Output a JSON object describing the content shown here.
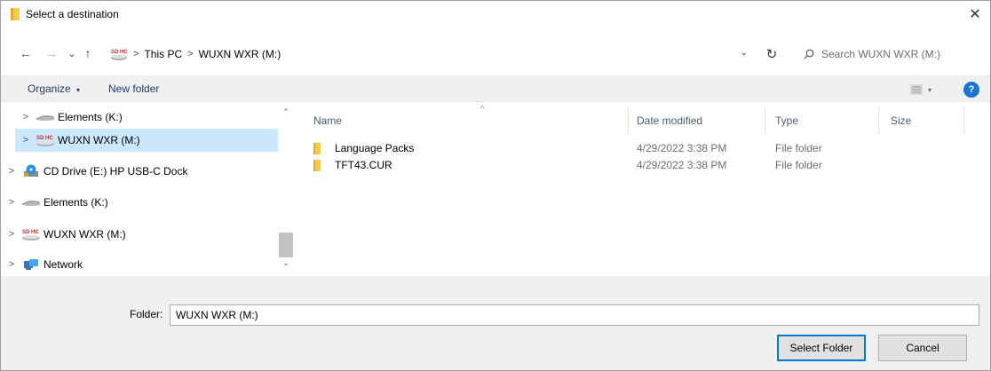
{
  "window": {
    "title": "Select a destination",
    "close_glyph": "✕"
  },
  "nav": {
    "back_glyph": "←",
    "forward_glyph": "→",
    "recent_glyph": "⌄",
    "up_glyph": "↑"
  },
  "address": {
    "sd_icon_text": "SD HC",
    "crumbs": [
      "This PC",
      "WUXN WXR (M:)"
    ],
    "separator": ">",
    "dropdown_glyph": "⌄",
    "refresh_glyph": "↻"
  },
  "search": {
    "placeholder": "Search WUXN WXR (M:)",
    "icon": "search-icon"
  },
  "toolbar": {
    "organize_label": "Organize",
    "organize_caret": "▾",
    "new_folder_label": "New folder",
    "view_caret": "▾",
    "help_label": "?"
  },
  "navpane": {
    "items": [
      {
        "label": "Elements (K:)",
        "icon": "drive-icon",
        "selected": false
      },
      {
        "label": "WUXN WXR (M:)",
        "icon": "sdhc-icon",
        "selected": true
      },
      {
        "label": "CD Drive (E:) HP USB-C Dock",
        "icon": "cd-drive-icon",
        "selected": false
      },
      {
        "label": "Elements (K:)",
        "icon": "drive-icon",
        "selected": false
      },
      {
        "label": "WUXN WXR (M:)",
        "icon": "sdhc-icon",
        "selected": false
      },
      {
        "label": "Network",
        "icon": "network-icon",
        "selected": false
      }
    ],
    "chevron": ">",
    "scroll_up_glyph": "⌃",
    "scroll_down_glyph": "⌄"
  },
  "filelist": {
    "columns": [
      "Name",
      "Date modified",
      "Type",
      "Size"
    ],
    "sort_glyph": "^",
    "rows": [
      {
        "name": "Language Packs",
        "date": "4/29/2022 3:38 PM",
        "type": "File folder",
        "size": ""
      },
      {
        "name": "TFT43.CUR",
        "date": "4/29/2022 3:38 PM",
        "type": "File folder",
        "size": ""
      }
    ]
  },
  "bottom": {
    "folder_label": "Folder:",
    "folder_value": "WUXN WXR (M:)",
    "select_label": "Select Folder",
    "cancel_label": "Cancel"
  },
  "colors": {
    "selected_bg": "#cce8ff",
    "accent": "#0078d7",
    "folder": "#f8c94b",
    "help": "#1a74d2"
  }
}
